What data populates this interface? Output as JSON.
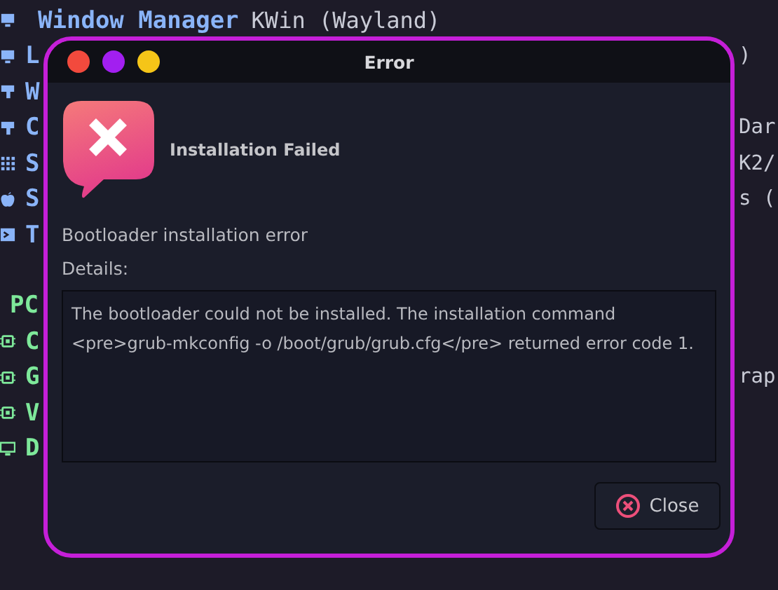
{
  "terminal": {
    "sections": [
      {
        "color": "#8ab4f8",
        "lines": [
          {
            "kind": "full",
            "key": "Window Manager",
            "value": "KWin (Wayland)"
          },
          {
            "kind": "clipped",
            "key": "L",
            "value": ")"
          },
          {
            "kind": "clipped",
            "key": "W"
          },
          {
            "kind": "clipped",
            "key": "C",
            "value": "Dar"
          },
          {
            "kind": "clipped",
            "key": "S",
            "value": "K2/"
          },
          {
            "kind": "clipped",
            "key": "S",
            "value": "s ("
          },
          {
            "kind": "clipped",
            "key": "T"
          }
        ]
      },
      {
        "color": "#7ee89a",
        "header": "PC",
        "lines": [
          {
            "kind": "clipped",
            "key": "C"
          },
          {
            "kind": "clipped",
            "key": "G",
            "value": "rap"
          },
          {
            "kind": "clipped",
            "key": "V"
          },
          {
            "kind": "clipped",
            "key": "D"
          }
        ]
      }
    ]
  },
  "dialog": {
    "title": "Error",
    "window_controls": [
      {
        "color": "#f24a3d"
      },
      {
        "color": "#a21ff0"
      },
      {
        "color": "#f5c518"
      }
    ],
    "heading": "Installation Failed",
    "message": "Bootloader installation error",
    "details_label": "Details:",
    "details": "The bootloader could not be installed. The installation command <pre>grub-mkconfig -o /boot/grub/grub.cfg</pre> returned error code 1.",
    "button": "Close"
  }
}
